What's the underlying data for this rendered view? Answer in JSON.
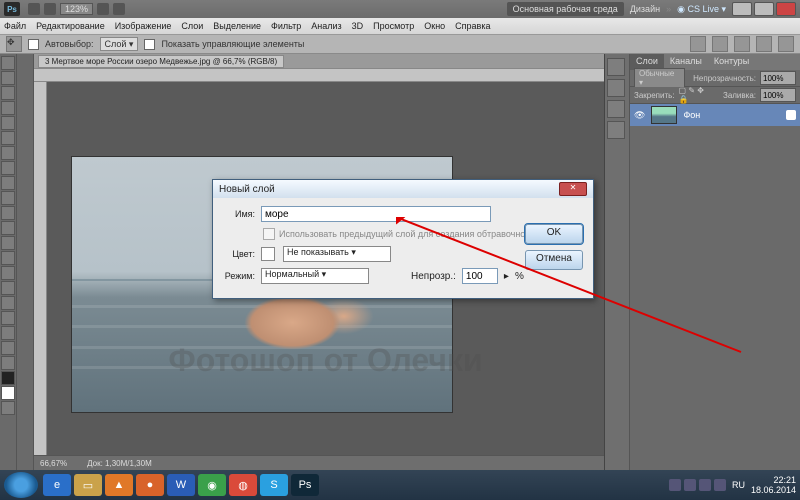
{
  "titlebar": {
    "logo": "Ps",
    "zoom_combo": "123%",
    "workspace_btn": "Основная рабочая среда",
    "design": "Дизайн",
    "cslive": "CS Live"
  },
  "menu": [
    "Файл",
    "Редактирование",
    "Изображение",
    "Слои",
    "Выделение",
    "Фильтр",
    "Анализ",
    "3D",
    "Просмотр",
    "Окно",
    "Справка"
  ],
  "optbar": {
    "autoselect": "Автовыбор:",
    "autoselect_val": "Слой",
    "show_controls": "Показать управляющие элементы"
  },
  "doc_tab": "3 Мертвое море России озеро Медвежье.jpg @ 66,7% (RGB/8)",
  "watermark": "Фотошоп от Олечки",
  "status": {
    "zoom": "66,67%",
    "doc": "Док: 1,30M/1,30M"
  },
  "panels": {
    "tabs": [
      "Слои",
      "Каналы",
      "Контуры"
    ],
    "mode": "Обычные",
    "opacity_lbl": "Непрозрачность:",
    "opacity": "100%",
    "lock_lbl": "Закрепить:",
    "fill_lbl": "Заливка:",
    "fill": "100%",
    "layer_name": "Фон"
  },
  "dialog": {
    "title": "Новый слой",
    "name_lbl": "Имя:",
    "name_val": "море",
    "clip": "Использовать предыдущий слой для создания обтравочной маски",
    "color_lbl": "Цвет:",
    "color_val": "Не показывать",
    "mode_lbl": "Режим:",
    "mode_val": "Нормальный",
    "op_lbl": "Непрозр.:",
    "op_val": "100",
    "op_pct": "%",
    "ok": "OK",
    "cancel": "Отмена"
  },
  "taskbar": {
    "lang": "RU",
    "time": "22:21",
    "date": "18.06.2014"
  }
}
